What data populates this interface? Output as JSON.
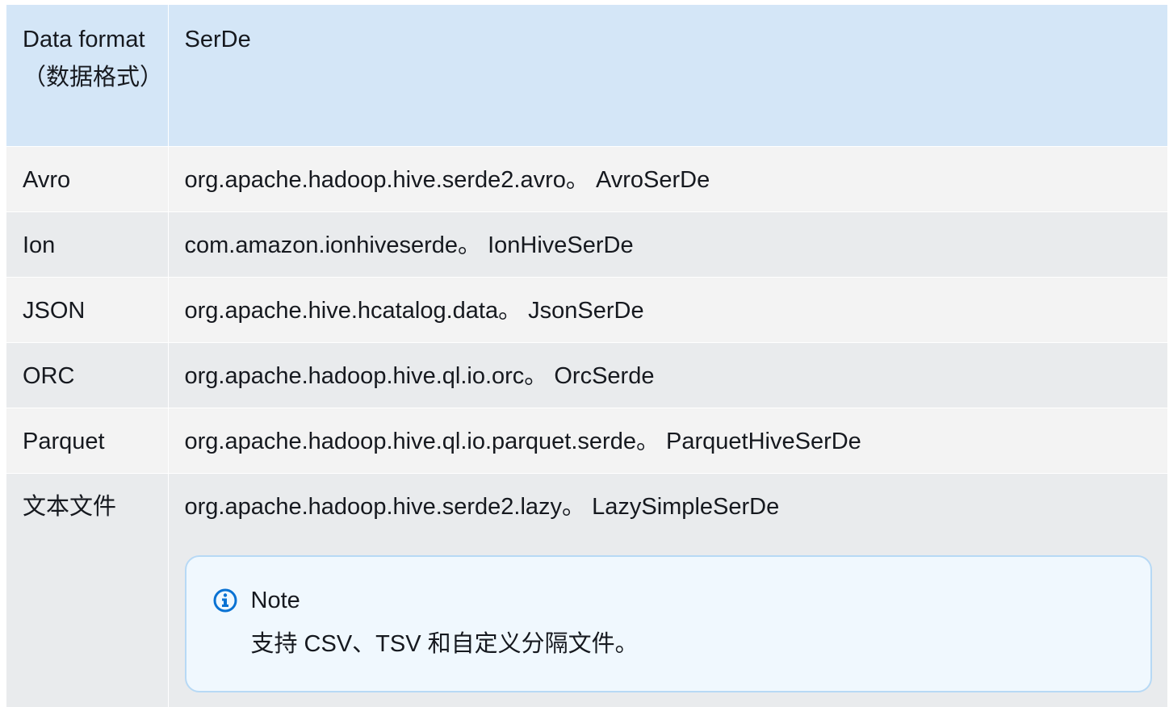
{
  "table": {
    "headers": [
      "Data format（数据格式）",
      "SerDe"
    ],
    "rows": [
      {
        "format": "Avro",
        "serde": "org.apache.hadoop.hive.serde2.avro。 AvroSerDe"
      },
      {
        "format": "Ion",
        "serde": "com.amazon.ionhiveserde。 IonHiveSerDe"
      },
      {
        "format": "JSON",
        "serde": "org.apache.hive.hcatalog.data。 JsonSerDe"
      },
      {
        "format": "ORC",
        "serde": "org.apache.hadoop.hive.ql.io.orc。 OrcSerde"
      },
      {
        "format": "Parquet",
        "serde": "org.apache.hadoop.hive.ql.io.parquet.serde。 ParquetHiveSerDe"
      },
      {
        "format": "文本文件",
        "serde": "org.apache.hadoop.hive.serde2.lazy。 LazySimpleSerDe"
      }
    ]
  },
  "note": {
    "icon": "info-icon",
    "title": "Note",
    "body": "支持 CSV、TSV 和自定义分隔文件。"
  },
  "colors": {
    "header_bg": "#d4e6f7",
    "row_odd_bg": "#f3f3f3",
    "row_even_bg": "#e9ebed",
    "note_bg": "#f0f8fe",
    "note_border": "#b7d9f5",
    "icon_blue": "#0972d3"
  }
}
